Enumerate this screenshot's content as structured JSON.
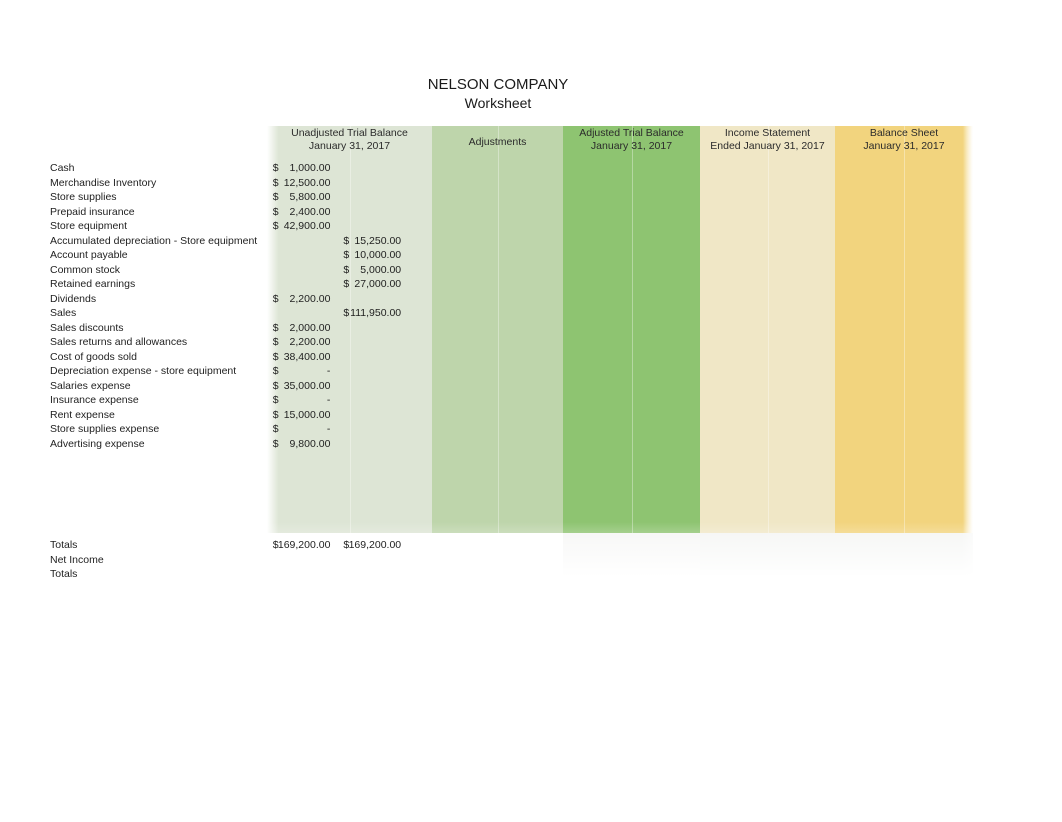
{
  "title": {
    "company": "NELSON COMPANY",
    "document": "Worksheet"
  },
  "colors": {
    "unadjusted_trial_balance": "#dde5d5",
    "adjustments": "#bed5ab",
    "adjusted_trial_balance": "#8ec471",
    "income_statement": "#f0e7c6",
    "balance_sheet": "#f2d47e",
    "text": "#1f1f1f"
  },
  "columns": [
    {
      "key": "utb",
      "line1": "Unadjusted Trial Balance",
      "line2": "January 31, 2017"
    },
    {
      "key": "adj",
      "line1": "Adjustments",
      "line2": ""
    },
    {
      "key": "atb",
      "line1": "Adjusted Trial Balance",
      "line2": "January 31, 2017"
    },
    {
      "key": "inc",
      "line1": "Income Statement",
      "line2": "Ended January 31, 2017"
    },
    {
      "key": "bal",
      "line1": "Balance Sheet",
      "line2": "January 31, 2017"
    }
  ],
  "rows": [
    {
      "account": "Cash",
      "utb_dr": "1,000.00",
      "utb_cr": ""
    },
    {
      "account": "Merchandise Inventory",
      "utb_dr": "12,500.00",
      "utb_cr": ""
    },
    {
      "account": "Store supplies",
      "utb_dr": "5,800.00",
      "utb_cr": ""
    },
    {
      "account": "Prepaid insurance",
      "utb_dr": "2,400.00",
      "utb_cr": ""
    },
    {
      "account": "Store equipment",
      "utb_dr": "42,900.00",
      "utb_cr": ""
    },
    {
      "account": "Accumulated depreciation - Store equipment",
      "utb_dr": "",
      "utb_cr": "15,250.00"
    },
    {
      "account": "Account payable",
      "utb_dr": "",
      "utb_cr": "10,000.00"
    },
    {
      "account": "Common stock",
      "utb_dr": "",
      "utb_cr": "5,000.00"
    },
    {
      "account": "Retained earnings",
      "utb_dr": "",
      "utb_cr": "27,000.00"
    },
    {
      "account": "Dividends",
      "utb_dr": "2,200.00",
      "utb_cr": ""
    },
    {
      "account": "Sales",
      "utb_dr": "",
      "utb_cr": "111,950.00"
    },
    {
      "account": "Sales discounts",
      "utb_dr": "2,000.00",
      "utb_cr": ""
    },
    {
      "account": "Sales returns and allowances",
      "utb_dr": "2,200.00",
      "utb_cr": ""
    },
    {
      "account": "Cost of goods sold",
      "utb_dr": "38,400.00",
      "utb_cr": ""
    },
    {
      "account": "Depreciation expense - store equipment",
      "utb_dr": "-",
      "utb_cr": ""
    },
    {
      "account": "Salaries expense",
      "utb_dr": "35,000.00",
      "utb_cr": ""
    },
    {
      "account": "Insurance expense",
      "utb_dr": "-",
      "utb_cr": ""
    },
    {
      "account": "Rent expense",
      "utb_dr": "15,000.00",
      "utb_cr": ""
    },
    {
      "account": "Store supplies expense",
      "utb_dr": "-",
      "utb_cr": ""
    },
    {
      "account": "Advertising expense",
      "utb_dr": "9,800.00",
      "utb_cr": ""
    }
  ],
  "blank_row_count": 6,
  "summary": [
    {
      "account": "Totals",
      "utb_dr": "169,200.00",
      "utb_cr": "169,200.00"
    },
    {
      "account": "Net Income",
      "utb_dr": "",
      "utb_cr": ""
    },
    {
      "account": "Totals",
      "utb_dr": "",
      "utb_cr": ""
    }
  ],
  "currency_symbol": "$"
}
